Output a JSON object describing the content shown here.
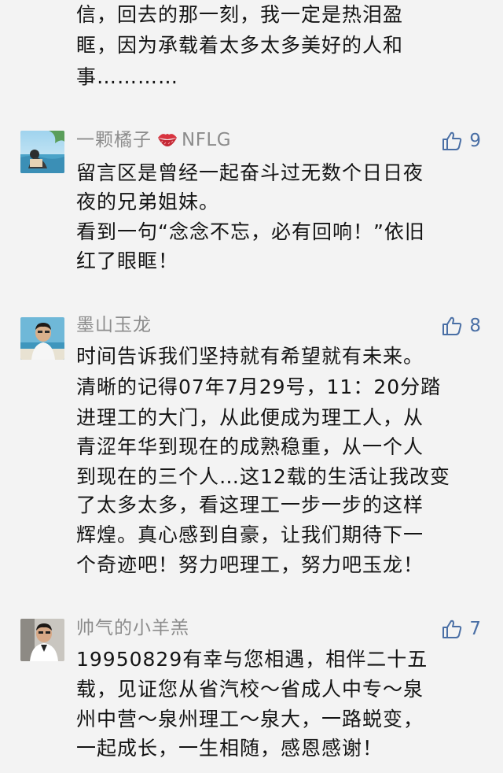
{
  "comments": [
    {
      "continued": true,
      "lines": [
        "信，回去的那一刻，我一定是热泪盈",
        "眶，因为承载着太多太多美好的人和",
        "事…………"
      ]
    },
    {
      "nickname": "一颗橘子",
      "nickname_suffix": "NFLG",
      "nickname_icon": "kiss-lips-icon",
      "likes": "9",
      "lines": [
        "留言区是曾经一起奋斗过无数个日日夜",
        "夜的兄弟姐妹。",
        "看到一句“念念不忘，必有回响！”依旧",
        "红了眼眶！"
      ]
    },
    {
      "nickname": "墨山玉龙",
      "likes": "8",
      "lines": [
        "时间告诉我们坚持就有希望就有未来。",
        "清晰的记得07年7月29号，11：20分踏",
        "进理工的大门，从此便成为理工人，从",
        "青涩年华到现在的成熟稳重，从一个人",
        "到现在的三个人…这12载的生活让我改变",
        "了太多太多，看这理工一步一步的这样",
        "辉煌。真心感到自豪，让我们期待下一",
        "个奇迹吧！努力吧理工，努力吧玉龙！"
      ]
    },
    {
      "nickname": "帅气的小羊羔",
      "likes": "7",
      "lines": [
        "19950829有幸与您相遇，相伴二十五",
        "载，见证您从省汽校～省成人中专～泉",
        "州中营～泉州理工～泉大，一路蜕变，",
        "一起成长，一生相随，感恩感谢！"
      ]
    }
  ],
  "colors": {
    "background": "#f3f3f3",
    "text": "#141414",
    "nickname": "#8c8c8c",
    "like": "#4a6fa5",
    "kiss": "#d8333f"
  }
}
